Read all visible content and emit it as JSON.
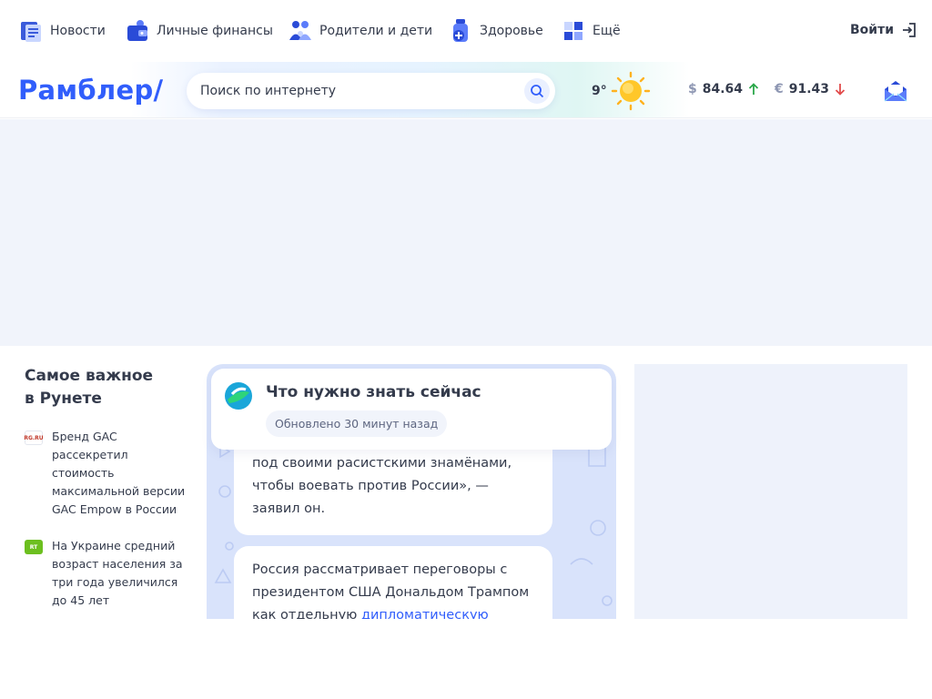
{
  "nav": {
    "items": [
      {
        "label": "Новости",
        "icon": "news-icon"
      },
      {
        "label": "Личные финансы",
        "icon": "wallet-icon"
      },
      {
        "label": "Родители и дети",
        "icon": "family-icon"
      },
      {
        "label": "Здоровье",
        "icon": "medicine-icon"
      },
      {
        "label": "Ещё",
        "icon": "grid-icon"
      }
    ],
    "login_label": "Войти"
  },
  "header": {
    "logo": "Рамблер/",
    "search_placeholder": "Поиск по интернету",
    "weather_temp": "9°",
    "rates": [
      {
        "symbol": "$",
        "value": "84.64",
        "trend": "up",
        "trend_color": "#2ba84a"
      },
      {
        "symbol": "€",
        "value": "91.43",
        "trend": "down",
        "trend_color": "#e24b4b"
      }
    ]
  },
  "sidebar": {
    "title_line1": "Самое важное",
    "title_line2": "в Рунете",
    "news": [
      {
        "source": "RG.RU",
        "text": "Бренд GAC рассекретил стоимость максимальной версии GAC Empow в России"
      },
      {
        "source": "RT",
        "text": "На Украине средний возраст населения за три года увеличился до 45 лет"
      }
    ]
  },
  "feed": {
    "title": "Что нужно знать сейчас",
    "updated": "Обновлено 30 минут назад",
    "card1_text": "под своими расистскими знамёнами, чтобы воевать против России», — заявил он.",
    "card2_text": "Россия рассматривает переговоры с президентом США Дональдом Трампом как отдельную ",
    "card2_link": "дипломатическую линию"
  },
  "colors": {
    "brand": "#315efb",
    "text": "#343b4c",
    "ad_bg": "#f1f4fb",
    "feed_bg": "#d9e3fb"
  }
}
